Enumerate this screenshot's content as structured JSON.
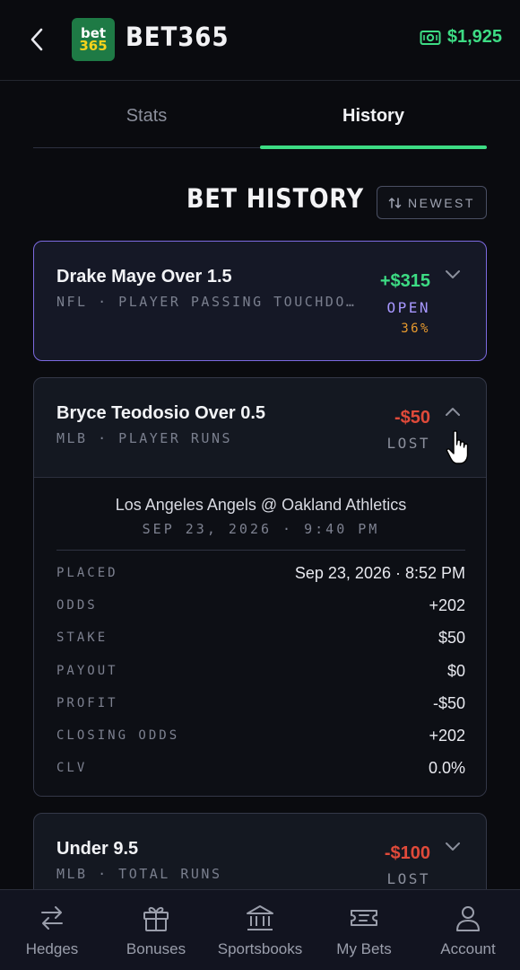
{
  "header": {
    "logo_line1": "bet",
    "logo_line2": "365",
    "title": "BET365",
    "balance": "$1,925",
    "icons": {
      "back": "chevron-left-icon",
      "balance": "cash-icon"
    }
  },
  "tabs": [
    {
      "label": "Stats",
      "active": false
    },
    {
      "label": "History",
      "active": true
    }
  ],
  "section": {
    "title": "BET HISTORY",
    "sort_label": "NEWEST"
  },
  "bets": [
    {
      "title": "Drake Maye Over 1.5",
      "subtitle": "NFL · PLAYER PASSING TOUCHDOWNS",
      "amount": "+$315",
      "status": "OPEN",
      "percent": "36%",
      "expanded": false
    },
    {
      "title": "Bryce Teodosio Over 0.5",
      "subtitle": "MLB · PLAYER RUNS",
      "amount": "-$50",
      "status": "LOST",
      "expanded": true,
      "game": "Los Angeles Angels @ Oakland Athletics",
      "game_time": "SEP 23, 2026 · 9:40 PM",
      "details": [
        {
          "label": "PLACED",
          "value": "Sep 23, 2026 · 8:52 PM"
        },
        {
          "label": "ODDS",
          "value": "+202"
        },
        {
          "label": "STAKE",
          "value": "$50"
        },
        {
          "label": "PAYOUT",
          "value": "$0"
        },
        {
          "label": "PROFIT",
          "value": "-$50"
        },
        {
          "label": "CLOSING ODDS",
          "value": "+202"
        },
        {
          "label": "CLV",
          "value": "0.0%"
        }
      ]
    },
    {
      "title": "Under 9.5",
      "subtitle": "MLB · TOTAL RUNS",
      "amount": "-$100",
      "status": "LOST",
      "expanded": false
    }
  ],
  "nav": [
    {
      "label": "Hedges",
      "icon": "arrows-swap-icon"
    },
    {
      "label": "Bonuses",
      "icon": "gift-icon"
    },
    {
      "label": "Sportsbooks",
      "icon": "bank-icon"
    },
    {
      "label": "My Bets",
      "icon": "ticket-icon"
    },
    {
      "label": "Account",
      "icon": "user-icon"
    }
  ],
  "colors": {
    "accent": "#3ddc84",
    "loss": "#e04a3a",
    "open": "#a797ff",
    "percent": "#e89a2e",
    "clv": "#e9c53a"
  }
}
